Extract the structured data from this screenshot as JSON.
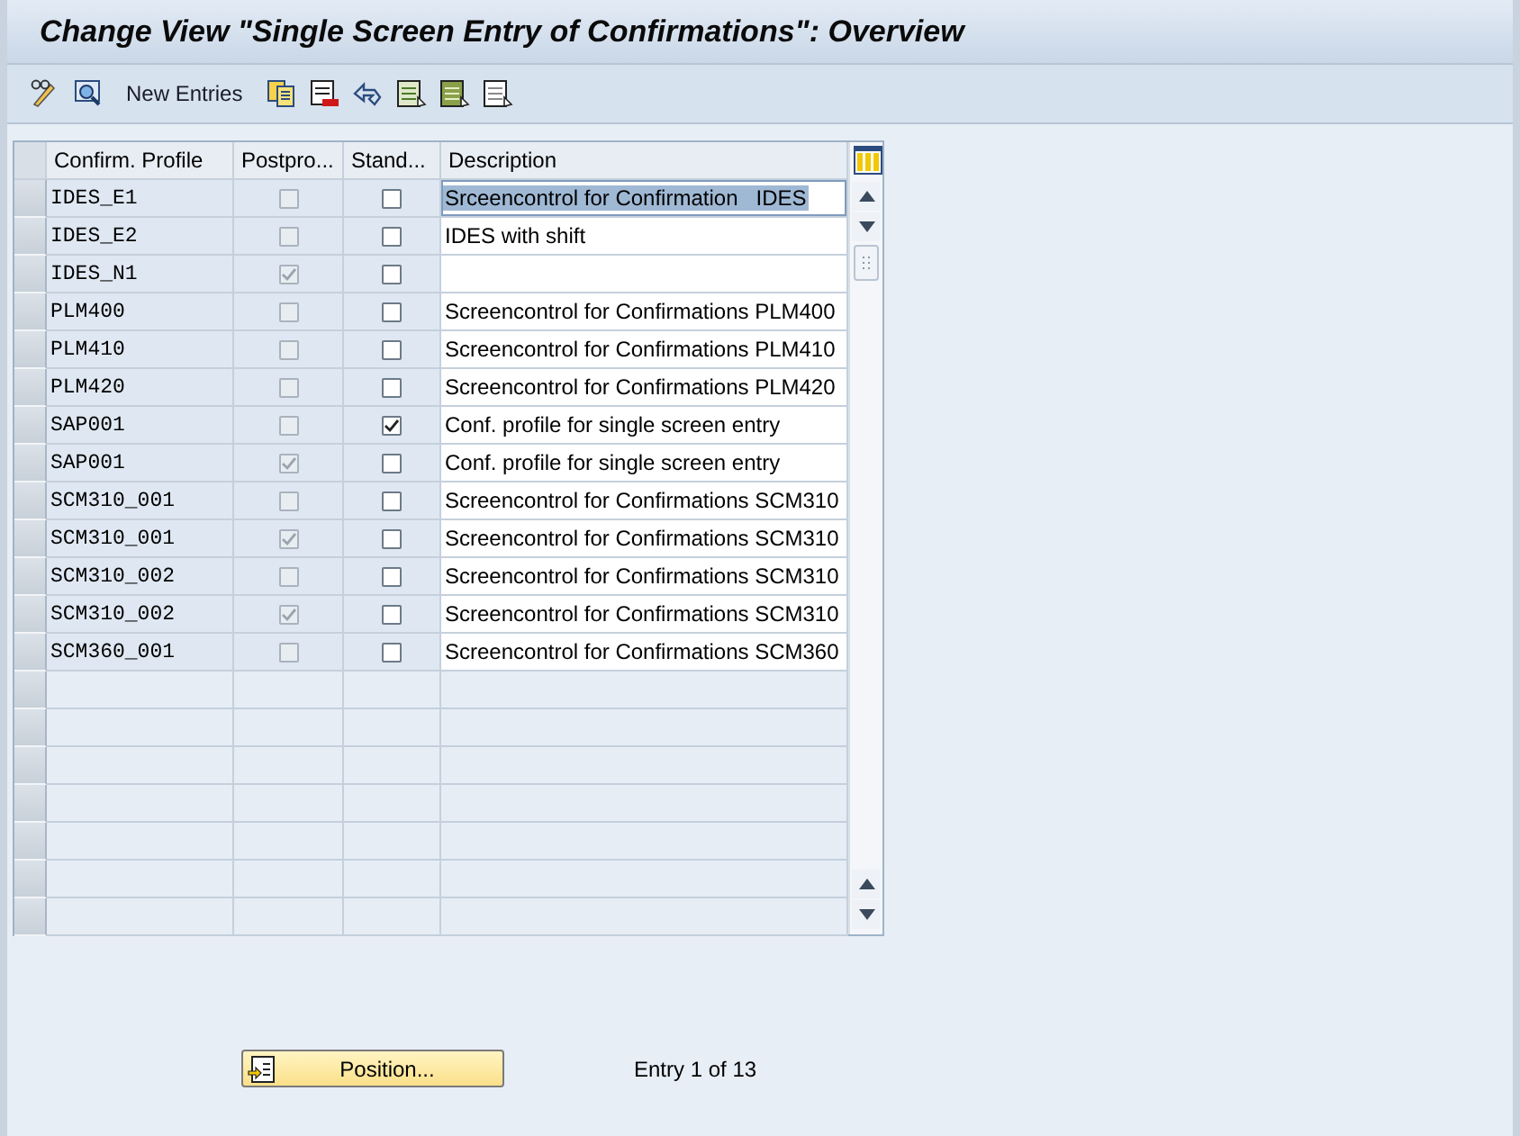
{
  "window": {
    "title": "Change View \"Single Screen Entry of Confirmations\": Overview"
  },
  "toolbar": {
    "new_entries": "New Entries"
  },
  "table": {
    "columns": [
      "Confirm. Profile",
      "Postpro...",
      "Stand...",
      "Description"
    ],
    "rows": [
      {
        "profile": "IDES_E1",
        "postprocessing": {
          "checked": false,
          "disabled": true
        },
        "standard": {
          "checked": false,
          "disabled": false
        },
        "description": "Srceencontrol for Confirmation   IDES",
        "selected": true
      },
      {
        "profile": "IDES_E2",
        "postprocessing": {
          "checked": false,
          "disabled": true
        },
        "standard": {
          "checked": false,
          "disabled": false
        },
        "description": "IDES with shift",
        "selected": false
      },
      {
        "profile": "IDES_N1",
        "postprocessing": {
          "checked": true,
          "disabled": true
        },
        "standard": {
          "checked": false,
          "disabled": false
        },
        "description": "",
        "selected": false
      },
      {
        "profile": "PLM400",
        "postprocessing": {
          "checked": false,
          "disabled": true
        },
        "standard": {
          "checked": false,
          "disabled": false
        },
        "description": "Screencontrol for Confirmations PLM400",
        "selected": false
      },
      {
        "profile": "PLM410",
        "postprocessing": {
          "checked": false,
          "disabled": true
        },
        "standard": {
          "checked": false,
          "disabled": false
        },
        "description": "Screencontrol for Confirmations PLM410",
        "selected": false
      },
      {
        "profile": "PLM420",
        "postprocessing": {
          "checked": false,
          "disabled": true
        },
        "standard": {
          "checked": false,
          "disabled": false
        },
        "description": "Screencontrol for Confirmations PLM420",
        "selected": false
      },
      {
        "profile": "SAP001",
        "postprocessing": {
          "checked": false,
          "disabled": true
        },
        "standard": {
          "checked": true,
          "disabled": false
        },
        "description": "Conf. profile for single screen entry",
        "selected": false
      },
      {
        "profile": "SAP001",
        "postprocessing": {
          "checked": true,
          "disabled": true
        },
        "standard": {
          "checked": false,
          "disabled": false
        },
        "description": "Conf. profile for single screen entry",
        "selected": false
      },
      {
        "profile": "SCM310_001",
        "postprocessing": {
          "checked": false,
          "disabled": true
        },
        "standard": {
          "checked": false,
          "disabled": false
        },
        "description": "Screencontrol for Confirmations SCM310",
        "selected": false
      },
      {
        "profile": "SCM310_001",
        "postprocessing": {
          "checked": true,
          "disabled": true
        },
        "standard": {
          "checked": false,
          "disabled": false
        },
        "description": "Screencontrol for Confirmations SCM310",
        "selected": false
      },
      {
        "profile": "SCM310_002",
        "postprocessing": {
          "checked": false,
          "disabled": true
        },
        "standard": {
          "checked": false,
          "disabled": false
        },
        "description": "Screencontrol for Confirmations SCM310",
        "selected": false
      },
      {
        "profile": "SCM310_002",
        "postprocessing": {
          "checked": true,
          "disabled": true
        },
        "standard": {
          "checked": false,
          "disabled": false
        },
        "description": "Screencontrol for Confirmations SCM310",
        "selected": false
      },
      {
        "profile": "SCM360_001",
        "postprocessing": {
          "checked": false,
          "disabled": true
        },
        "standard": {
          "checked": false,
          "disabled": false
        },
        "description": "Screencontrol for Confirmations SCM360",
        "selected": false
      }
    ]
  },
  "footer": {
    "position_button": "Position...",
    "entry_info": "Entry 1 of 13"
  }
}
